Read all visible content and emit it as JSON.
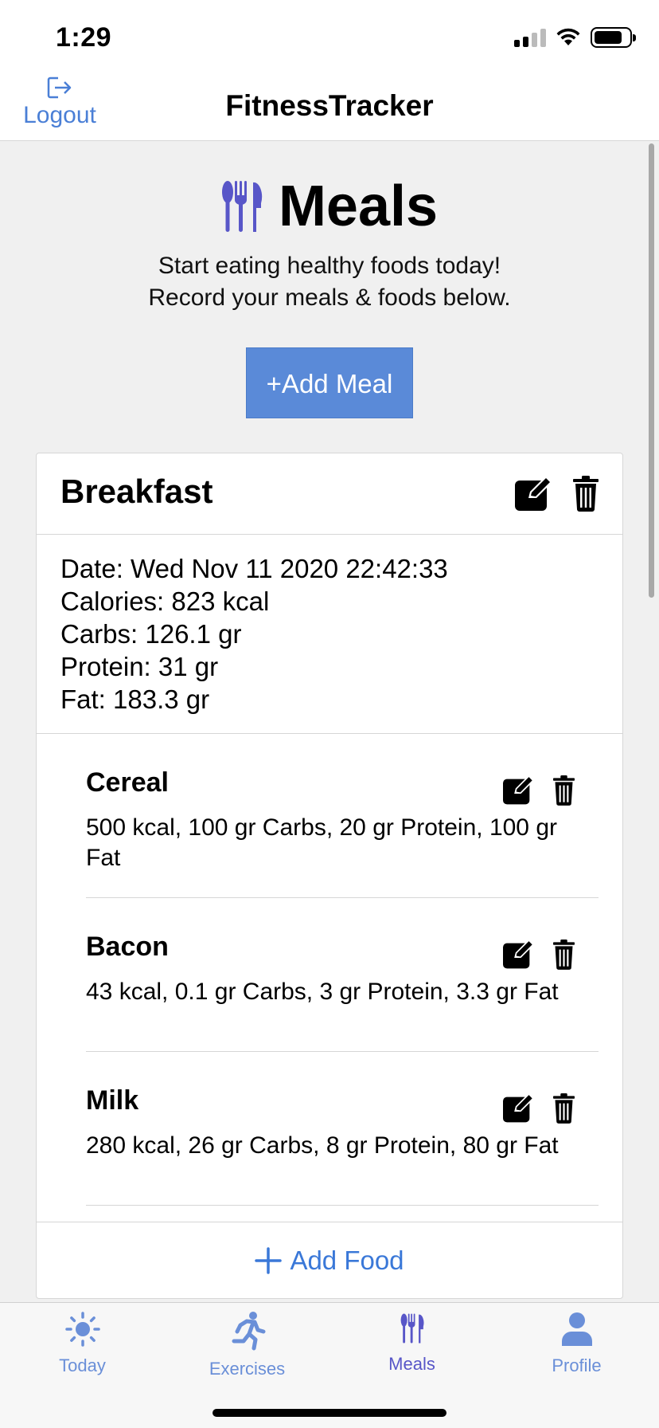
{
  "status_bar": {
    "time": "1:29"
  },
  "nav": {
    "logout_label": "Logout",
    "title": "FitnessTracker"
  },
  "page": {
    "title": "Meals",
    "subtitle_line1": "Start eating healthy foods today!",
    "subtitle_line2": "Record your meals & foods below.",
    "add_meal_label": "+Add Meal"
  },
  "meal": {
    "name": "Breakfast",
    "date": "Date: Wed Nov 11 2020 22:42:33",
    "calories": "Calories: 823 kcal",
    "carbs": "Carbs: 126.1 gr",
    "protein": "Protein: 31 gr",
    "fat": "Fat: 183.3 gr",
    "foods": [
      {
        "name": "Cereal",
        "desc": "500 kcal, 100 gr Carbs, 20 gr Protein, 100 gr Fat"
      },
      {
        "name": "Bacon",
        "desc": "43 kcal, 0.1 gr Carbs, 3 gr Protein, 3.3 gr Fat"
      },
      {
        "name": "Milk",
        "desc": "280 kcal, 26 gr Carbs, 8 gr Protein, 80 gr Fat"
      }
    ],
    "add_food_label": "Add Food"
  },
  "tabs": [
    {
      "label": "Today",
      "icon": "sun-icon"
    },
    {
      "label": "Exercises",
      "icon": "running-icon"
    },
    {
      "label": "Meals",
      "icon": "utensils-icon",
      "active": true
    },
    {
      "label": "Profile",
      "icon": "person-icon"
    }
  ],
  "colors": {
    "accent": "#5a8ad8",
    "link": "#3a78d8",
    "tab_active": "#5856c8",
    "tab_inactive": "#6a8fd8",
    "utensils": "#5856c8"
  }
}
